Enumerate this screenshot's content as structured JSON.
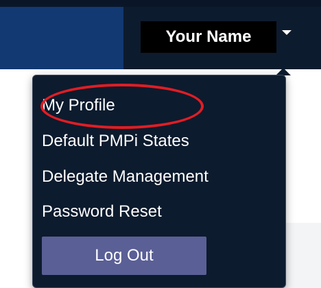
{
  "header": {
    "user_name": "Your Name"
  },
  "menu": {
    "items": [
      "My Profile",
      "Default PMPi States",
      "Delegate Management",
      "Password Reset"
    ],
    "logout_label": "Log Out"
  },
  "icons": {
    "caret": "caret-down-icon"
  },
  "colors": {
    "nav_dark": "#0d1b2e",
    "nav_blue": "#123972",
    "logout_button": "#5a5f96",
    "highlight": "#e11d24"
  }
}
